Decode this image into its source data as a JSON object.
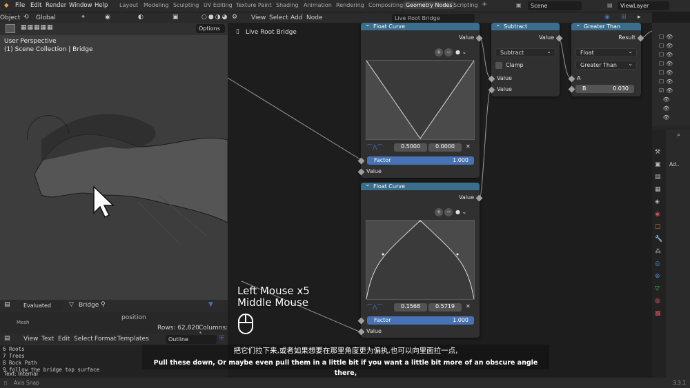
{
  "menu": {
    "object_label": "Object",
    "file": "File",
    "edit": "Edit",
    "render": "Render",
    "window": "Window",
    "help": "Help"
  },
  "workspaces": [
    "Layout",
    "Modeling",
    "Sculpting",
    "UV Editing",
    "Texture Paint",
    "Shading",
    "Animation",
    "Rendering",
    "Compositing",
    "Geometry Nodes",
    "Scripting"
  ],
  "active_workspace": "Geometry Nodes",
  "scene": "Scene",
  "view_layer": "ViewLayer",
  "viewport": {
    "orientation": "Global",
    "options": "Options",
    "perspective": "User Perspective",
    "collection": "(1) Scene Collection | Bridge"
  },
  "nodetree": {
    "name": "Live Root Bridge",
    "menu_view": "View",
    "menu_select": "Select",
    "menu_add": "Add",
    "menu_node": "Node",
    "breadcrumb": "Live Root Bridge"
  },
  "nodes": {
    "fc1": {
      "title": "Float Curve",
      "out": "Value",
      "p1": "0.5000",
      "p2": "0.0000",
      "factor": "Factor",
      "factor_val": "1.000",
      "in": "Value"
    },
    "fc2": {
      "title": "Float Curve",
      "out": "Value",
      "p1": "0.1568",
      "p2": "0.5719",
      "factor": "Factor",
      "factor_val": "1.000",
      "in": "Value"
    },
    "sub": {
      "title": "Subtract",
      "out": "Value",
      "op": "Subtract",
      "clamp": "Clamp",
      "in1": "Value",
      "in2": "Value"
    },
    "gt": {
      "title": "Greater Than",
      "out": "Result",
      "type": "Float",
      "op": "Greater Than",
      "a": "A",
      "b": "B",
      "b_val": "0.030"
    }
  },
  "spreadsheet": {
    "mode": "Evaluated",
    "object": "Bridge",
    "column": "position",
    "domain": "Mesh",
    "rows": "Rows: 62,820",
    "cols": "Columns: 1"
  },
  "texteditor": {
    "view": "View",
    "text": "Text",
    "edit": "Edit",
    "select": "Select",
    "format": "Format",
    "templates": "Templates",
    "name": "Outline",
    "lines": [
      "6  Roots",
      "7  Trees",
      "8  Rock Path",
      "9      follow the bridge top surface"
    ],
    "footer": "Text: Internal"
  },
  "overlay": {
    "line1": "Left Mouse x5",
    "line2": "Middle Mouse"
  },
  "subtitle": {
    "zh": "把它们拉下来,或者如果想要在那里角度更为偏执,也可以向里面拉一点,",
    "en": "Pull these down, Or maybe even pull them in a little bit if you want a little bit more of an obscure angle there,"
  },
  "status": {
    "left": "Axis Snap",
    "version": "3.3.1"
  },
  "props": {
    "add_label": "Ad.."
  },
  "colors": {
    "node_header": "#3b6e8c",
    "accent": "#4772b3"
  }
}
